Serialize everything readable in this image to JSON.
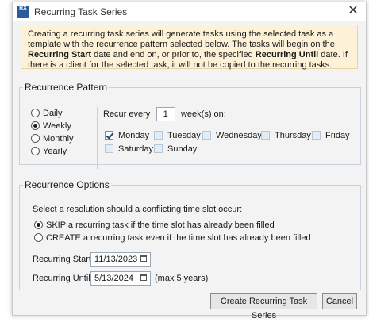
{
  "window": {
    "title": "Recurring Task Series",
    "app_icon_text": "RX"
  },
  "notice": {
    "part1": "Creating a recurring task series will generate tasks using the selected task as a template with the recurrence pattern selected below. The tasks will begin on the ",
    "bold1": "Recurring Start",
    "part2": " date and end on, or prior to, the specified ",
    "bold2": "Recurring Until",
    "part3": " date. If there is a client for the selected task, it will not be copied to the recurring tasks."
  },
  "pattern": {
    "legend": "Recurrence Pattern",
    "frequencies": [
      {
        "label": "Daily",
        "selected": false
      },
      {
        "label": "Weekly",
        "selected": true
      },
      {
        "label": "Monthly",
        "selected": false
      },
      {
        "label": "Yearly",
        "selected": false
      }
    ],
    "recur_prefix": "Recur every",
    "recur_value": "1",
    "recur_suffix": "week(s) on:",
    "days": [
      {
        "label": "Monday",
        "checked": true
      },
      {
        "label": "Tuesday",
        "checked": false
      },
      {
        "label": "Wednesday",
        "checked": false
      },
      {
        "label": "Thursday",
        "checked": false
      },
      {
        "label": "Friday",
        "checked": false
      },
      {
        "label": "Saturday",
        "checked": false
      },
      {
        "label": "Sunday",
        "checked": false
      }
    ]
  },
  "options": {
    "legend": "Recurrence Options",
    "conflict_prompt": "Select a resolution should a conflicting time slot occur:",
    "conflict_choices": [
      {
        "label": "SKIP a recurring task if the time slot has already been filled",
        "selected": true
      },
      {
        "label": "CREATE a recurring task even if the time slot has already been filled",
        "selected": false
      }
    ],
    "start_label": "Recurring Start:",
    "start_value": "11/13/2023",
    "until_label": "Recurring Until:",
    "until_value": "5/13/2024",
    "until_note": "(max 5 years)"
  },
  "buttons": {
    "create": "Create Recurring Task Series",
    "cancel": "Cancel"
  },
  "icons": {
    "close": "close-icon",
    "calendar": "calendar-icon"
  }
}
